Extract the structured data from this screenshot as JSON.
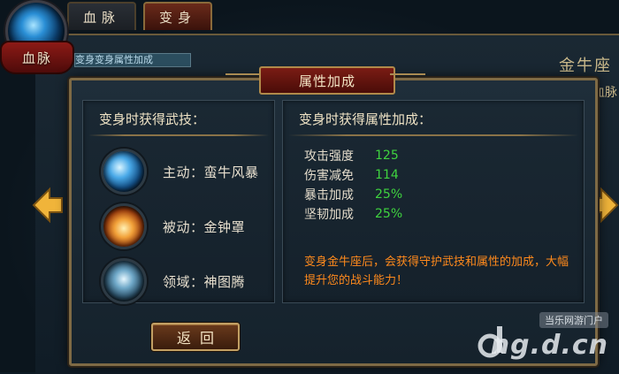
{
  "emblem": {
    "label": "血脉"
  },
  "tabs": [
    {
      "label": "血脉"
    },
    {
      "label": "变身"
    }
  ],
  "background": {
    "strip_text": "变身变身属性加成",
    "right_title": "金牛座",
    "right_sub": "血脉"
  },
  "modal": {
    "title": "属性加成",
    "skills_header": "变身时获得武技：",
    "skills": [
      {
        "label": "主动：蛮牛风暴",
        "icon": "storm-icon"
      },
      {
        "label": "被动：金钟罩",
        "icon": "golden-bell-icon"
      },
      {
        "label": "领域：神图腾",
        "icon": "totem-icon"
      }
    ],
    "attrs_header": "变身时获得属性加成：",
    "attributes": [
      {
        "name": "攻击强度",
        "value": "125"
      },
      {
        "name": "伤害减免",
        "value": "114"
      },
      {
        "name": "暴击加成",
        "value": "25%"
      },
      {
        "name": "坚韧加成",
        "value": "25%"
      }
    ],
    "description": "变身金牛座后，会获得守护武技和属性的加成，大幅提升您的战斗能力！",
    "back_label": "返回"
  },
  "watermark": {
    "top": "当乐网游门户",
    "domain": "ng.d.cn"
  },
  "colors": {
    "accent_gold": "#7e6a45",
    "title_red": "#7a1c14",
    "value_green": "#3fd33f",
    "desc_orange": "#ff8a1c"
  }
}
